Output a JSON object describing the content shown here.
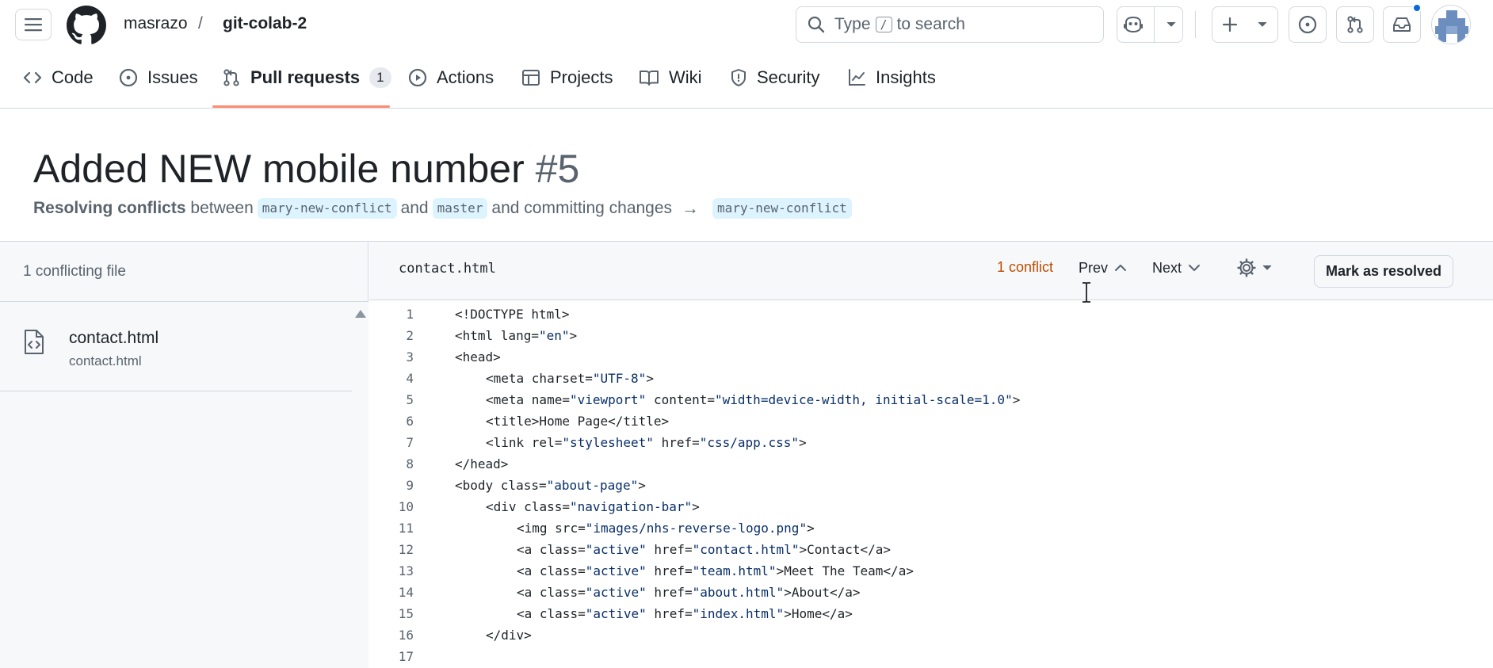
{
  "header": {
    "owner": "masrazo",
    "separator": "/",
    "repo": "git-colab-2",
    "search": {
      "prefix": "Type",
      "kbd": "/",
      "suffix": "to search"
    }
  },
  "nav": {
    "tabs": [
      {
        "label": "Code",
        "icon": "code-icon"
      },
      {
        "label": "Issues",
        "icon": "issue-opened-icon"
      },
      {
        "label": "Pull requests",
        "icon": "git-pull-request-icon",
        "counter": "1",
        "selected": true
      },
      {
        "label": "Actions",
        "icon": "play-icon"
      },
      {
        "label": "Projects",
        "icon": "table-icon"
      },
      {
        "label": "Wiki",
        "icon": "book-icon"
      },
      {
        "label": "Security",
        "icon": "shield-icon"
      },
      {
        "label": "Insights",
        "icon": "graph-icon"
      }
    ]
  },
  "pr": {
    "title": "Added NEW mobile number",
    "number": "#5",
    "subtitle": {
      "lead": "Resolving conflicts",
      "between": "between",
      "head_branch": "mary-new-conflict",
      "and": "and",
      "base_branch": "master",
      "tail": "and committing changes",
      "arrow": "→",
      "target_branch": "mary-new-conflict"
    }
  },
  "sidebar": {
    "header": "1 conflicting file",
    "files": [
      {
        "name": "contact.html",
        "path": "contact.html"
      }
    ]
  },
  "editor": {
    "filename": "contact.html",
    "conflict_count": "1 conflict",
    "prev_label": "Prev",
    "next_label": "Next",
    "mark_resolved_label": "Mark as resolved",
    "lines": [
      {
        "n": "1",
        "indent": 0,
        "tokens": [
          [
            "t",
            "<!DOCTYPE html>"
          ]
        ]
      },
      {
        "n": "2",
        "indent": 0,
        "tokens": [
          [
            "t",
            "<html "
          ],
          [
            "a",
            "lang"
          ],
          [
            "t",
            "="
          ],
          [
            "s",
            "\"en\""
          ],
          [
            "t",
            ">"
          ]
        ]
      },
      {
        "n": "3",
        "indent": 0,
        "tokens": [
          [
            "t",
            "<head>"
          ]
        ]
      },
      {
        "n": "4",
        "indent": 1,
        "tokens": [
          [
            "t",
            "<meta "
          ],
          [
            "a",
            "charset"
          ],
          [
            "t",
            "="
          ],
          [
            "s",
            "\"UTF-8\""
          ],
          [
            "t",
            ">"
          ]
        ]
      },
      {
        "n": "5",
        "indent": 1,
        "tokens": [
          [
            "t",
            "<meta "
          ],
          [
            "a",
            "name"
          ],
          [
            "t",
            "="
          ],
          [
            "s",
            "\"viewport\""
          ],
          [
            "t",
            " "
          ],
          [
            "a",
            "content"
          ],
          [
            "t",
            "="
          ],
          [
            "s",
            "\"width=device-width, initial-scale=1.0\""
          ],
          [
            "t",
            ">"
          ]
        ]
      },
      {
        "n": "6",
        "indent": 1,
        "tokens": [
          [
            "t",
            "<title>Home Page</title>"
          ]
        ]
      },
      {
        "n": "7",
        "indent": 1,
        "tokens": [
          [
            "t",
            "<link "
          ],
          [
            "a",
            "rel"
          ],
          [
            "t",
            "="
          ],
          [
            "s",
            "\"stylesheet\""
          ],
          [
            "t",
            " "
          ],
          [
            "a",
            "href"
          ],
          [
            "t",
            "="
          ],
          [
            "s",
            "\"css/app.css\""
          ],
          [
            "t",
            ">"
          ]
        ]
      },
      {
        "n": "8",
        "indent": 0,
        "tokens": [
          [
            "t",
            "</head>"
          ]
        ]
      },
      {
        "n": "9",
        "indent": 0,
        "tokens": [
          [
            "t",
            "<body "
          ],
          [
            "a",
            "class"
          ],
          [
            "t",
            "="
          ],
          [
            "s",
            "\"about-page\""
          ],
          [
            "t",
            ">"
          ]
        ]
      },
      {
        "n": "10",
        "indent": 1,
        "tokens": [
          [
            "t",
            "<div "
          ],
          [
            "a",
            "class"
          ],
          [
            "t",
            "="
          ],
          [
            "s",
            "\"navigation-bar\""
          ],
          [
            "t",
            ">"
          ]
        ]
      },
      {
        "n": "11",
        "indent": 2,
        "tokens": [
          [
            "t",
            "<img "
          ],
          [
            "a",
            "src"
          ],
          [
            "t",
            "="
          ],
          [
            "s",
            "\"images/nhs-reverse-logo.png\""
          ],
          [
            "t",
            ">"
          ]
        ]
      },
      {
        "n": "12",
        "indent": 2,
        "tokens": [
          [
            "t",
            "<a "
          ],
          [
            "a",
            "class"
          ],
          [
            "t",
            "="
          ],
          [
            "s",
            "\"active\""
          ],
          [
            "t",
            " "
          ],
          [
            "a",
            "href"
          ],
          [
            "t",
            "="
          ],
          [
            "s",
            "\"contact.html\""
          ],
          [
            "t",
            ">Contact</a>"
          ]
        ]
      },
      {
        "n": "13",
        "indent": 2,
        "tokens": [
          [
            "t",
            "<a "
          ],
          [
            "a",
            "class"
          ],
          [
            "t",
            "="
          ],
          [
            "s",
            "\"active\""
          ],
          [
            "t",
            " "
          ],
          [
            "a",
            "href"
          ],
          [
            "t",
            "="
          ],
          [
            "s",
            "\"team.html\""
          ],
          [
            "t",
            ">Meet The Team</a>"
          ]
        ]
      },
      {
        "n": "14",
        "indent": 2,
        "tokens": [
          [
            "t",
            "<a "
          ],
          [
            "a",
            "class"
          ],
          [
            "t",
            "="
          ],
          [
            "s",
            "\"active\""
          ],
          [
            "t",
            " "
          ],
          [
            "a",
            "href"
          ],
          [
            "t",
            "="
          ],
          [
            "s",
            "\"about.html\""
          ],
          [
            "t",
            ">About</a>"
          ]
        ]
      },
      {
        "n": "15",
        "indent": 2,
        "tokens": [
          [
            "t",
            "<a "
          ],
          [
            "a",
            "class"
          ],
          [
            "t",
            "="
          ],
          [
            "s",
            "\"active\""
          ],
          [
            "t",
            " "
          ],
          [
            "a",
            "href"
          ],
          [
            "t",
            "="
          ],
          [
            "s",
            "\"index.html\""
          ],
          [
            "t",
            ">Home</a>"
          ]
        ]
      },
      {
        "n": "16",
        "indent": 1,
        "tokens": [
          [
            "t",
            "</div>"
          ]
        ]
      },
      {
        "n": "17",
        "indent": 0,
        "tokens": []
      }
    ]
  },
  "colors": {
    "accent_underline": "#fd8c73",
    "conflict_text": "#bc4c00",
    "branch_bg": "#ddf4ff",
    "code_attr": "#1f2328",
    "code_string": "#0a3069",
    "notification": "#0969da"
  }
}
